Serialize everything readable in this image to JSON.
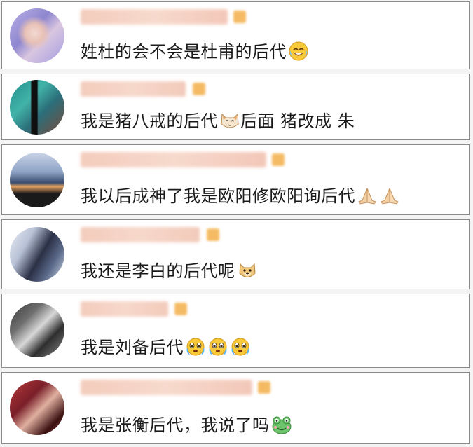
{
  "comments": [
    {
      "text": "姓杜的会不会是杜甫的后代",
      "emoji": [
        "tears-of-joy-icon"
      ]
    },
    {
      "text": "我是猪八戒的后代",
      "emoji_mid": "cat-face-icon",
      "text_after": "后面 猪改成 朱"
    },
    {
      "text": "我以后成神了我是欧阳修欧阳询后代",
      "emoji": [
        "pray-hands-icon",
        "pray-hands-icon"
      ]
    },
    {
      "text": "我还是李白的后代呢",
      "emoji": [
        "doge-icon"
      ]
    },
    {
      "text": "我是刘备后代",
      "emoji": [
        "crying-face-icon",
        "crying-face-icon",
        "crying-face-icon"
      ]
    },
    {
      "text": "我是张衡后代，我说了吗",
      "emoji": [
        "frog-icon"
      ]
    }
  ],
  "colors": {
    "card_border": "#8a8a8a",
    "name_blur": "#f2c7b6",
    "badge": "#f3b04a",
    "text": "#1a1a1a"
  }
}
